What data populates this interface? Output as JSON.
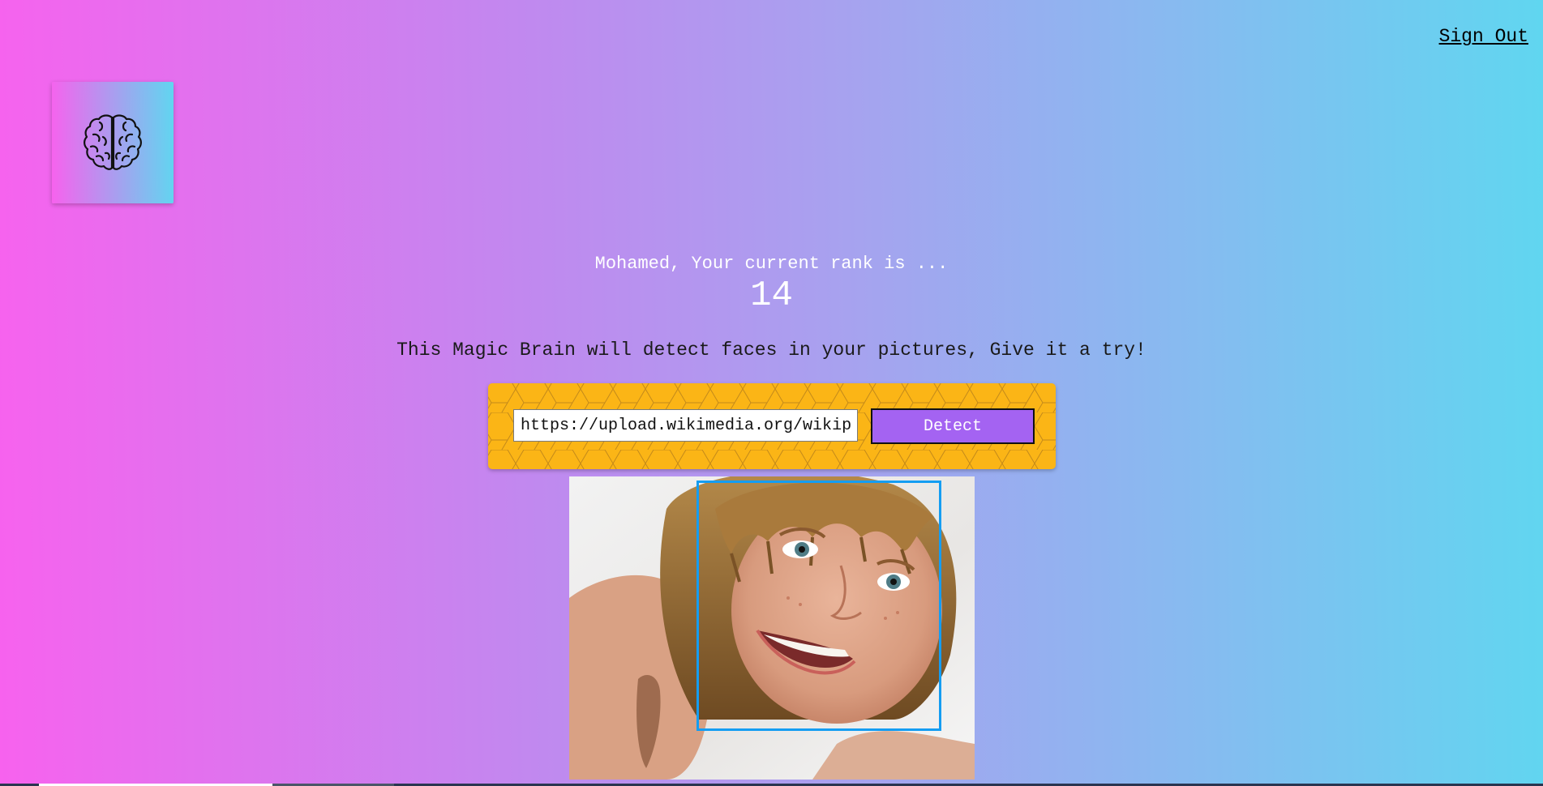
{
  "nav": {
    "signout_label": "Sign Out"
  },
  "logo": {
    "icon": "brain-icon"
  },
  "rank": {
    "message": "Mohamed, Your current rank is ...",
    "value": "14"
  },
  "tagline": "This Magic Brain will detect faces in your pictures, Give it a try!",
  "form": {
    "url_value": "https://upload.wikimedia.org/wikipedia/commons/",
    "detect_label": "Detect"
  },
  "result": {
    "image": "portrait-photo",
    "face_box_color": "#149df2"
  },
  "colors": {
    "gradient_start": "#f762ee",
    "gradient_end": "#60d6f0",
    "panel": "#fbb516",
    "button": "#a463f2"
  }
}
